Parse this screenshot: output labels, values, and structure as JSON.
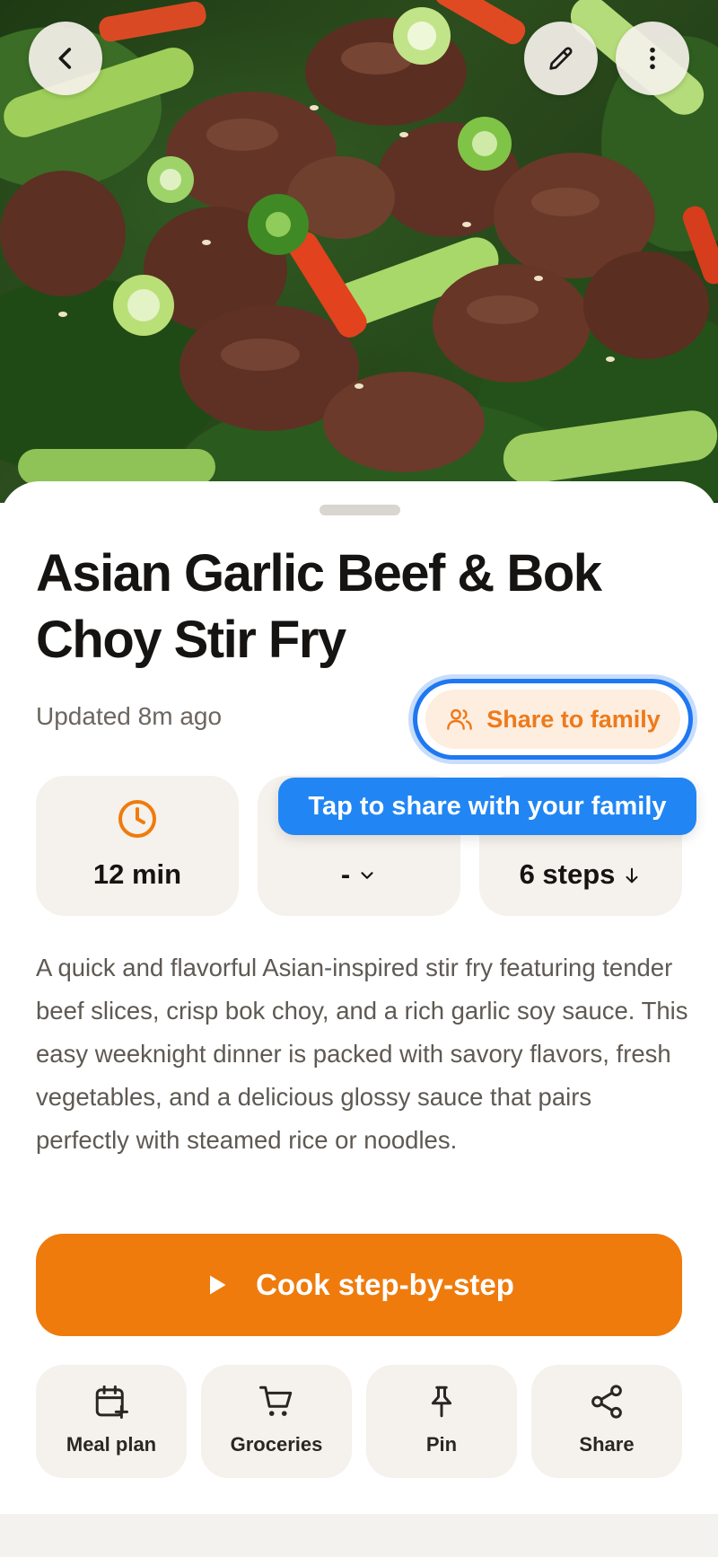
{
  "recipe": {
    "title": "Asian Garlic Beef & Bok Choy Stir Fry",
    "updated": "Updated 8m ago",
    "share_family_label": "Share to family",
    "tooltip": "Tap to share with your family",
    "stats": {
      "time": "12 min",
      "servings": "-",
      "steps": "6 steps"
    },
    "description": "A quick and flavorful Asian-inspired stir fry featuring tender beef slices, crisp bok choy, and a rich garlic soy sauce. This easy weeknight dinner is packed with savory flavors, fresh vegetables, and a delicious glossy sauce that pairs perfectly with steamed rice or noodles.",
    "cook_label": "Cook step-by-step"
  },
  "actions": [
    {
      "label": "Meal plan",
      "icon": "calendar-plus-icon"
    },
    {
      "label": "Groceries",
      "icon": "cart-icon"
    },
    {
      "label": "Pin",
      "icon": "pin-icon"
    },
    {
      "label": "Share",
      "icon": "share-icon"
    }
  ],
  "colors": {
    "accent": "#ef7b0d",
    "accent_soft": "#fdeee0",
    "tooltip_blue": "#2186f4",
    "card_bg": "#f5f1ec"
  }
}
